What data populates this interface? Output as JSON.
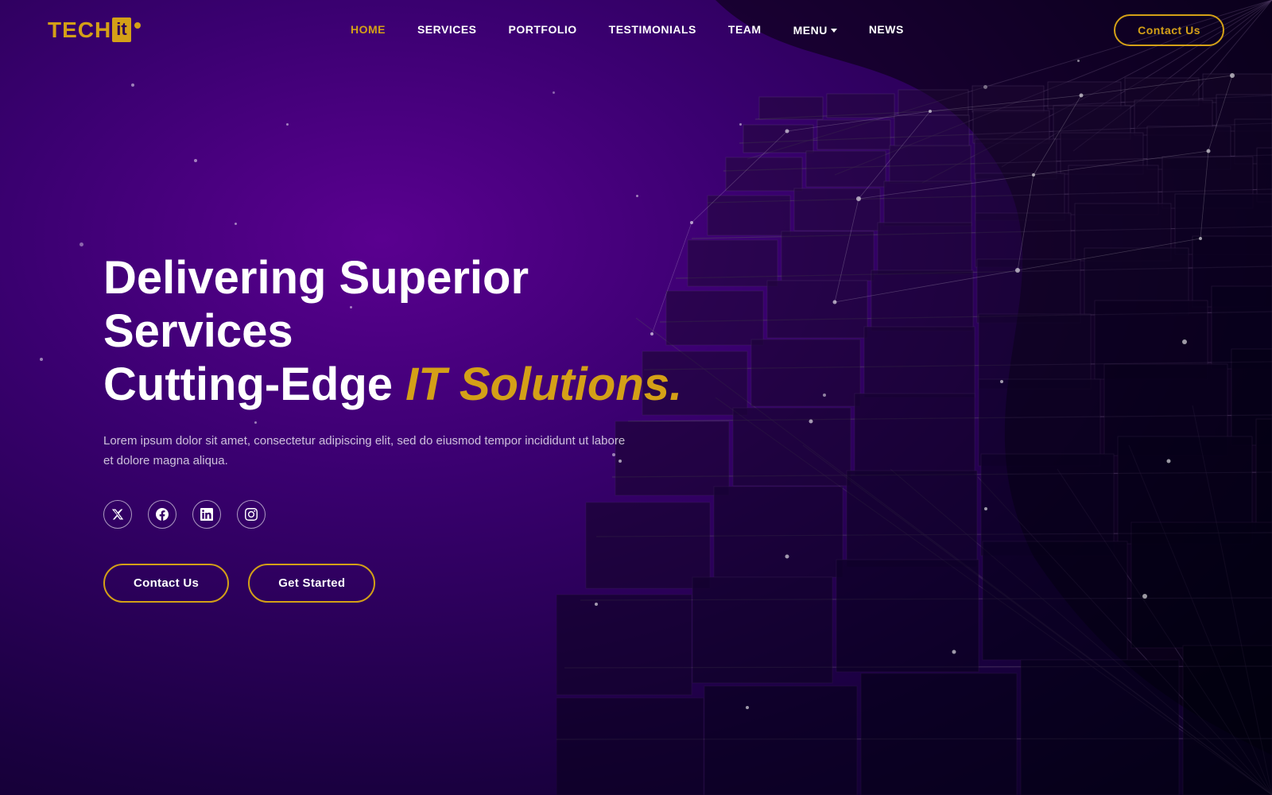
{
  "brand": {
    "tech": "TECH",
    "it": "it",
    "tagline": "◆"
  },
  "nav": {
    "links": [
      {
        "label": "HOME",
        "active": true
      },
      {
        "label": "SERVICES",
        "active": false
      },
      {
        "label": "PORTFOLIO",
        "active": false
      },
      {
        "label": "TESTIMONIALS",
        "active": false
      },
      {
        "label": "TEAM",
        "active": false
      },
      {
        "label": "MENU",
        "active": false,
        "hasDropdown": true
      },
      {
        "label": "NEWS",
        "active": false
      }
    ],
    "contact_btn": "Contact Us"
  },
  "hero": {
    "title_line1": "Delivering Superior Services",
    "title_line2": "Cutting-Edge ",
    "title_highlight": "IT Solutions.",
    "description": "Lorem ipsum dolor sit amet, consectetur adipiscing elit, sed do eiusmod tempor incididunt ut labore et dolore magna aliqua.",
    "btn_contact": "Contact Us",
    "btn_get_started": "Get Started"
  },
  "social": [
    {
      "name": "twitter",
      "icon": "𝕏"
    },
    {
      "name": "facebook",
      "icon": "f"
    },
    {
      "name": "linkedin",
      "icon": "in"
    },
    {
      "name": "instagram",
      "icon": "◉"
    }
  ],
  "colors": {
    "gold": "#d4a017",
    "purple_dark": "#2d0057",
    "purple_mid": "#5a0090"
  }
}
